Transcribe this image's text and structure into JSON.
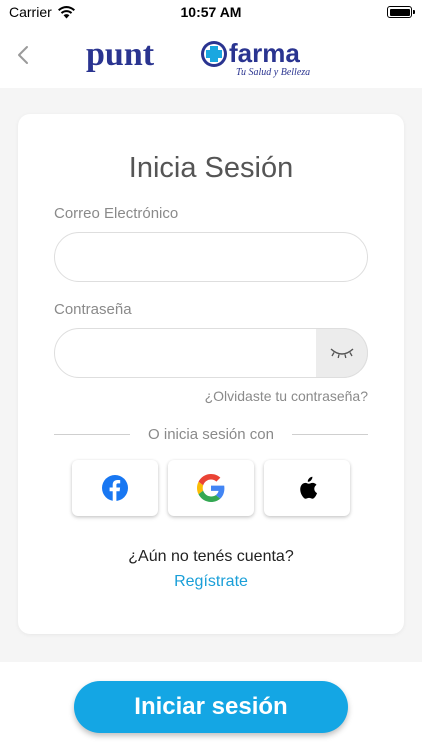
{
  "status_bar": {
    "carrier": "Carrier",
    "time": "10:57 AM"
  },
  "header": {
    "logo_text_left": "punt",
    "logo_text_right": "farma",
    "logo_tagline": "Tu Salud y Belleza"
  },
  "login": {
    "title": "Inicia Sesión",
    "email_label": "Correo Electrónico",
    "email_value": "",
    "password_label": "Contraseña",
    "password_value": "",
    "forgot_password": "¿Olvidaste tu contraseña?",
    "divider_text": "O inicia sesión con",
    "social": [
      "facebook",
      "google",
      "apple"
    ],
    "no_account": "¿Aún no tenés cuenta?",
    "register": "Regístrate"
  },
  "footer": {
    "submit_label": "Iniciar sesión"
  },
  "colors": {
    "accent": "#14a6e4",
    "link": "#1a9fd8",
    "logo_navy": "#2a3490",
    "facebook": "#1877f2"
  }
}
